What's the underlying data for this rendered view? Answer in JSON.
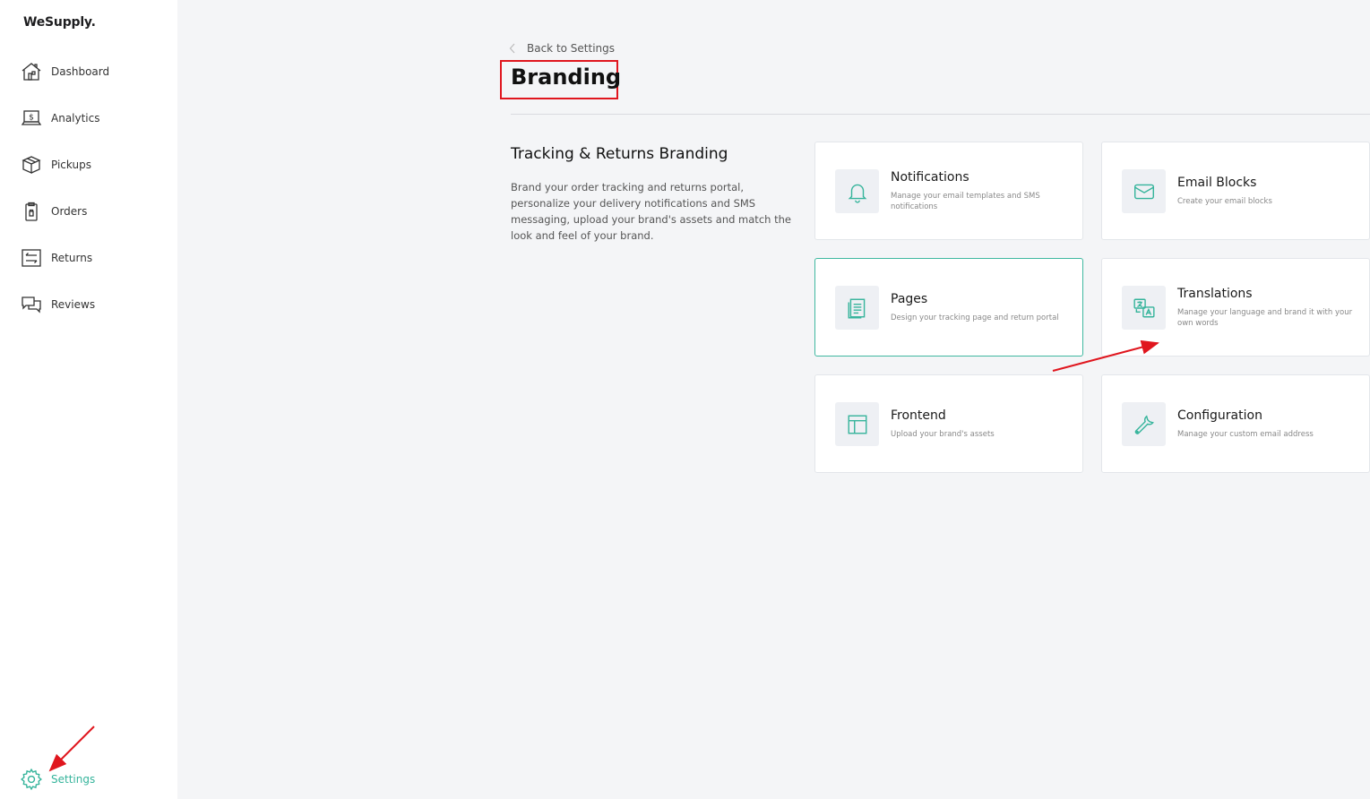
{
  "app": {
    "logo": "WeSupply."
  },
  "sidebar": {
    "items": [
      {
        "label": "Dashboard",
        "icon": "home-icon"
      },
      {
        "label": "Analytics",
        "icon": "laptop-dollar-icon"
      },
      {
        "label": "Pickups",
        "icon": "box-icon"
      },
      {
        "label": "Orders",
        "icon": "clipboard-icon"
      },
      {
        "label": "Returns",
        "icon": "returns-icon"
      },
      {
        "label": "Reviews",
        "icon": "chat-icon"
      }
    ],
    "settings": {
      "label": "Settings",
      "icon": "gear-icon"
    }
  },
  "header": {
    "back_label": "Back to Settings",
    "title": "Branding"
  },
  "section": {
    "title": "Tracking & Returns Branding",
    "description": "Brand your order tracking and returns portal, personalize your delivery notifications and SMS messaging, upload your brand's assets and match the look and feel of your brand."
  },
  "cards": [
    {
      "title": "Notifications",
      "desc": "Manage your email templates and SMS notifications",
      "icon": "bell-icon"
    },
    {
      "title": "Email Blocks",
      "desc": "Create your email blocks",
      "icon": "envelope-icon"
    },
    {
      "title": "Pages",
      "desc": "Design your tracking page and return portal",
      "icon": "document-icon"
    },
    {
      "title": "Translations",
      "desc": "Manage your language and brand it with your own words",
      "icon": "translate-icon"
    },
    {
      "title": "Frontend",
      "desc": "Upload your brand's assets",
      "icon": "layout-icon"
    },
    {
      "title": "Configuration",
      "desc": "Manage your custom email address",
      "icon": "wrench-icon"
    }
  ],
  "colors": {
    "accent": "#35b49b",
    "annotation": "#e0161e"
  }
}
